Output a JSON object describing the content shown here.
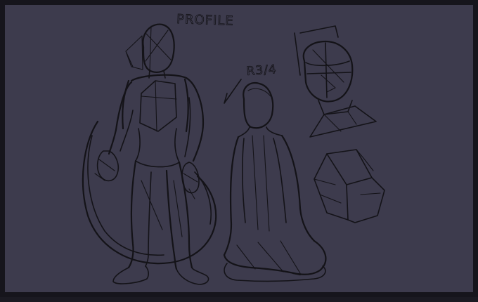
{
  "canvas": {
    "background": "#3d3b4d",
    "frame_color": "#16151c",
    "ink_color": "#141318"
  },
  "annotations": {
    "profile_label": "PROFILE",
    "three_quarter_label": "R3/4"
  }
}
